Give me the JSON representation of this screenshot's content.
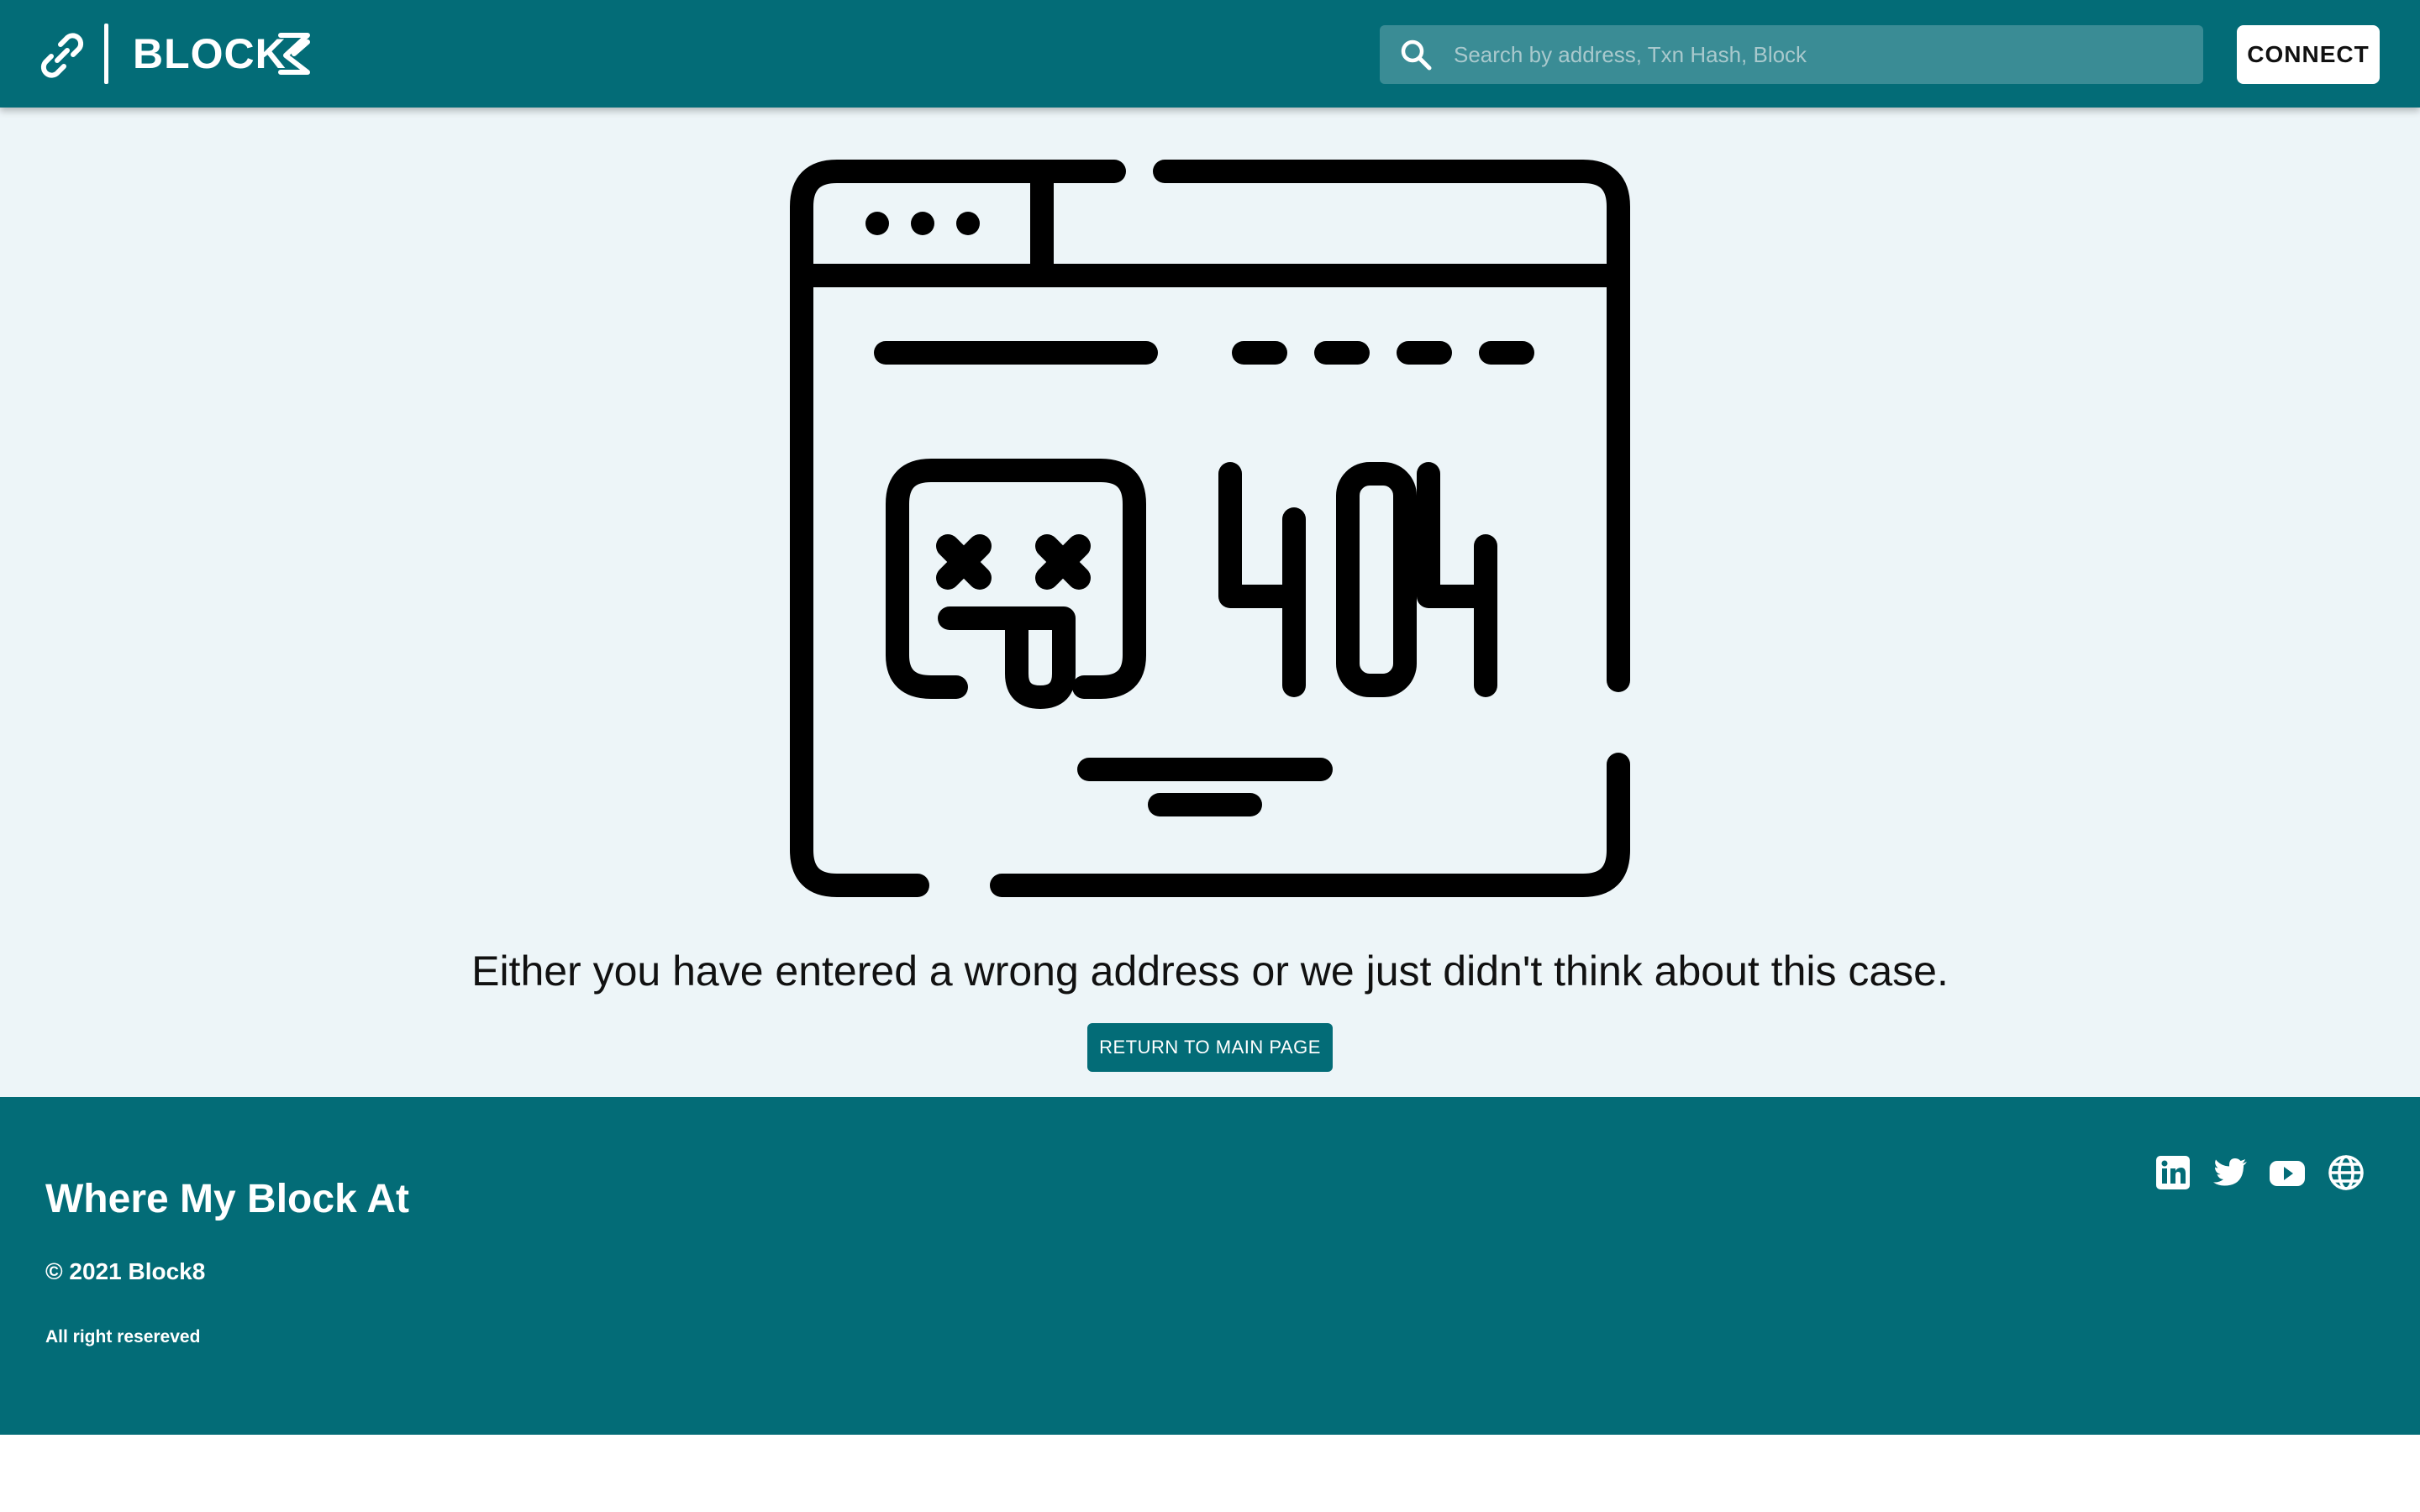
{
  "header": {
    "logo_text": "BLOCK",
    "search_placeholder": "Search by address, Txn Hash, Block",
    "connect_label": "CONNECT"
  },
  "illustration": {
    "code_text": "404"
  },
  "main": {
    "message": "Either you have entered a wrong address or we just didn't think about this case.",
    "return_label": "RETURN TO MAIN PAGE"
  },
  "footer": {
    "title": "Where My Block At",
    "copyright": "© 2021 Block8",
    "rights": "All right resereved",
    "social_icons": [
      "linkedin-icon",
      "twitter-icon",
      "youtube-icon",
      "globe-icon"
    ]
  },
  "colors": {
    "brand": "#036c77",
    "page_background": "#edf5f8",
    "search_background": "#3a8c95"
  }
}
